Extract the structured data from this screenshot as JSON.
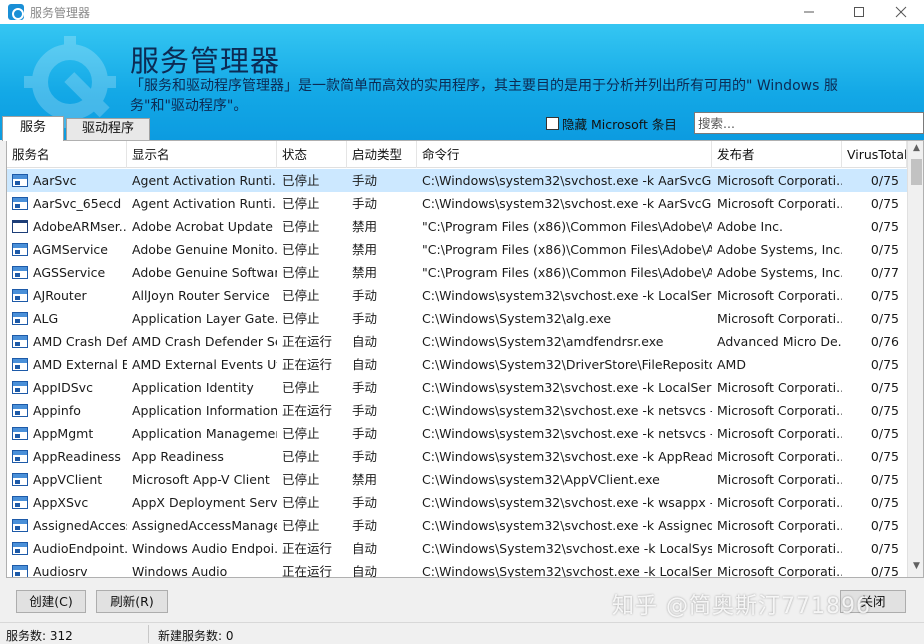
{
  "window": {
    "title": "服务管理器"
  },
  "banner": {
    "title": "服务管理器",
    "description": "「服务和驱动程序管理器」是一款简单而高效的实用程序，其主要目的是用于分析并列出所有可用的\" Windows 服务\"和\"驱动程序\"。"
  },
  "tabs": [
    {
      "label": "服务",
      "active": true
    },
    {
      "label": "驱动程序",
      "active": false
    }
  ],
  "filter": {
    "hide_ms_label": "隐藏 Microsoft 条目",
    "hide_ms_checked": false,
    "search_placeholder": "搜索..."
  },
  "columns": [
    "服务名",
    "显示名",
    "状态",
    "启动类型",
    "命令行",
    "发布者",
    "VirusTotal"
  ],
  "rows": [
    {
      "name": "AarSvc",
      "display": "Agent Activation Runti...",
      "status": "已停止",
      "start": "手动",
      "cmd": "C:\\Windows\\system32\\svchost.exe -k AarSvcGroup...",
      "publisher": "Microsoft Corporati...",
      "vt": "0/75",
      "icon": "service-icon",
      "selected": true
    },
    {
      "name": "AarSvc_65ecd",
      "display": "Agent Activation Runti...",
      "status": "已停止",
      "start": "手动",
      "cmd": "C:\\Windows\\system32\\svchost.exe -k AarSvcGroup...",
      "publisher": "Microsoft Corporati...",
      "vt": "0/75",
      "icon": "service-icon"
    },
    {
      "name": "AdobeARMser...",
      "display": "Adobe Acrobat Update ...",
      "status": "已停止",
      "start": "禁用",
      "cmd": "\"C:\\Program Files (x86)\\Common Files\\Adobe\\AR...",
      "publisher": "Adobe Inc.",
      "vt": "0/75",
      "icon": "window-icon"
    },
    {
      "name": "AGMService",
      "display": "Adobe Genuine Monito...",
      "status": "已停止",
      "start": "禁用",
      "cmd": "\"C:\\Program Files (x86)\\Common Files\\Adobe\\Ado...",
      "publisher": "Adobe Systems, Inc....",
      "vt": "0/75",
      "icon": "service-icon"
    },
    {
      "name": "AGSService",
      "display": "Adobe Genuine Softwar...",
      "status": "已停止",
      "start": "禁用",
      "cmd": "\"C:\\Program Files (x86)\\Common Files\\Adobe\\Ado...",
      "publisher": "Adobe Systems, Inc....",
      "vt": "0/77",
      "icon": "service-icon"
    },
    {
      "name": "AJRouter",
      "display": "AllJoyn Router Service",
      "status": "已停止",
      "start": "手动",
      "cmd": "C:\\Windows\\system32\\svchost.exe -k LocalService...",
      "publisher": "Microsoft Corporati...",
      "vt": "0/75",
      "icon": "service-icon"
    },
    {
      "name": "ALG",
      "display": "Application Layer Gate...",
      "status": "已停止",
      "start": "手动",
      "cmd": "C:\\Windows\\System32\\alg.exe",
      "publisher": "Microsoft Corporati...",
      "vt": "0/75",
      "icon": "service-icon"
    },
    {
      "name": "AMD Crash Def...",
      "display": "AMD Crash Defender Se...",
      "status": "正在运行",
      "start": "自动",
      "cmd": "C:\\Windows\\System32\\amdfendrsr.exe",
      "publisher": "Advanced Micro De...",
      "vt": "0/76",
      "icon": "service-icon"
    },
    {
      "name": "AMD External E...",
      "display": "AMD External Events Uti...",
      "status": "正在运行",
      "start": "自动",
      "cmd": "C:\\Windows\\System32\\DriverStore\\FileRepository\\...",
      "publisher": "AMD",
      "vt": "0/75",
      "icon": "service-icon"
    },
    {
      "name": "AppIDSvc",
      "display": "Application Identity",
      "status": "已停止",
      "start": "手动",
      "cmd": "C:\\Windows\\system32\\svchost.exe -k LocalService...",
      "publisher": "Microsoft Corporati...",
      "vt": "0/75",
      "icon": "service-icon"
    },
    {
      "name": "Appinfo",
      "display": "Application Information",
      "status": "正在运行",
      "start": "手动",
      "cmd": "C:\\Windows\\system32\\svchost.exe -k netsvcs -p",
      "publisher": "Microsoft Corporati...",
      "vt": "0/75",
      "icon": "service-icon"
    },
    {
      "name": "AppMgmt",
      "display": "Application Management",
      "status": "已停止",
      "start": "手动",
      "cmd": "C:\\Windows\\system32\\svchost.exe -k netsvcs -p",
      "publisher": "Microsoft Corporati...",
      "vt": "0/75",
      "icon": "service-icon"
    },
    {
      "name": "AppReadiness",
      "display": "App Readiness",
      "status": "已停止",
      "start": "手动",
      "cmd": "C:\\Windows\\system32\\svchost.exe -k AppReadines...",
      "publisher": "Microsoft Corporati...",
      "vt": "0/75",
      "icon": "service-icon"
    },
    {
      "name": "AppVClient",
      "display": "Microsoft App-V Client",
      "status": "已停止",
      "start": "禁用",
      "cmd": "C:\\Windows\\system32\\AppVClient.exe",
      "publisher": "Microsoft Corporati...",
      "vt": "0/75",
      "icon": "service-icon"
    },
    {
      "name": "AppXSvc",
      "display": "AppX Deployment Servi...",
      "status": "已停止",
      "start": "手动",
      "cmd": "C:\\Windows\\system32\\svchost.exe -k wsappx -p",
      "publisher": "Microsoft Corporati...",
      "vt": "0/75",
      "icon": "service-icon"
    },
    {
      "name": "AssignedAccess...",
      "display": "AssignedAccessManage...",
      "status": "已停止",
      "start": "手动",
      "cmd": "C:\\Windows\\system32\\svchost.exe -k AssignedAcc...",
      "publisher": "Microsoft Corporati...",
      "vt": "0/75",
      "icon": "service-icon"
    },
    {
      "name": "AudioEndpoint...",
      "display": "Windows Audio Endpoi...",
      "status": "正在运行",
      "start": "自动",
      "cmd": "C:\\Windows\\System32\\svchost.exe -k LocalSystem...",
      "publisher": "Microsoft Corporati...",
      "vt": "0/75",
      "icon": "service-icon"
    },
    {
      "name": "Audiosrv",
      "display": "Windows Audio",
      "status": "正在运行",
      "start": "自动",
      "cmd": "C:\\Windows\\System32\\svchost.exe -k LocalService...",
      "publisher": "Microsoft Corporati...",
      "vt": "0/75",
      "icon": "service-icon"
    }
  ],
  "buttons": {
    "create": "创建(C)",
    "refresh": "刷新(R)",
    "exit": "关闭"
  },
  "status": {
    "total": "服务数: 312",
    "new": "新建服务数: 0"
  },
  "watermark": "知乎 @简奥斯汀771896",
  "colors": {
    "banner": "#13a8e6",
    "selected_row": "#cce8ff",
    "title_text": "#0c2b54"
  }
}
